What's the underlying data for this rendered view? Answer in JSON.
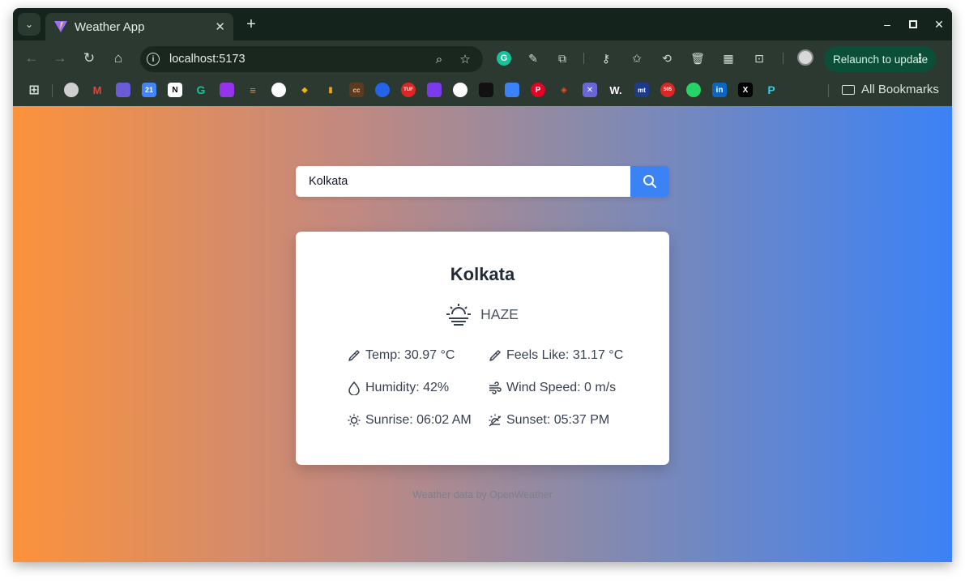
{
  "browser": {
    "tab_title": "Weather App",
    "tab_search_icon": "chevron-down-icon",
    "url": "localhost:5173",
    "relaunch_label": "Relaunch to update",
    "all_bookmarks_label": "All Bookmarks",
    "bookmarks": [
      "account-bookmark",
      "gmail-bookmark",
      "copilot-bookmark",
      "calendar-bookmark",
      "notion-bookmark",
      "grammarly-bookmark",
      "bookmark-7",
      "stackoverflow-bookmark",
      "github-bookmark",
      "bookmark-10",
      "bookmark-11",
      "codechef-bookmark",
      "bookmark-13",
      "takeuforward-bookmark",
      "bookmark-15",
      "openai-bookmark",
      "bookmark-17",
      "bookmark-18",
      "pinterest-bookmark",
      "figma-bookmark",
      "excalidraw-bookmark",
      "webflow-bookmark",
      "monkeytype-bookmark",
      "bookmark-24",
      "whatsapp-bookmark",
      "linkedin-bookmark",
      "x-bookmark",
      "bookmark-28"
    ],
    "bookmark_labels": {
      "tuf": "TUF",
      "cc": "cc",
      "w": "W.",
      "mt": "mt",
      "sos": "505",
      "in": "in",
      "x": "X",
      "cal": "21"
    }
  },
  "app": {
    "search": {
      "value": "Kolkata"
    },
    "weather": {
      "city": "Kolkata",
      "condition": "HAZE",
      "temp": "Temp: 30.97 °C",
      "feels_like": "Feels Like: 31.17 °C",
      "humidity": "Humidity: 42%",
      "wind": "Wind Speed: 0 m/s",
      "sunrise": "Sunrise: 06:02 AM",
      "sunset": "Sunset: 05:37 PM"
    },
    "footer": "Weather data by OpenWeather"
  },
  "colors": {
    "gradient_start": "#fb923c",
    "gradient_end": "#3b82f6",
    "search_button": "#3b82f6"
  }
}
